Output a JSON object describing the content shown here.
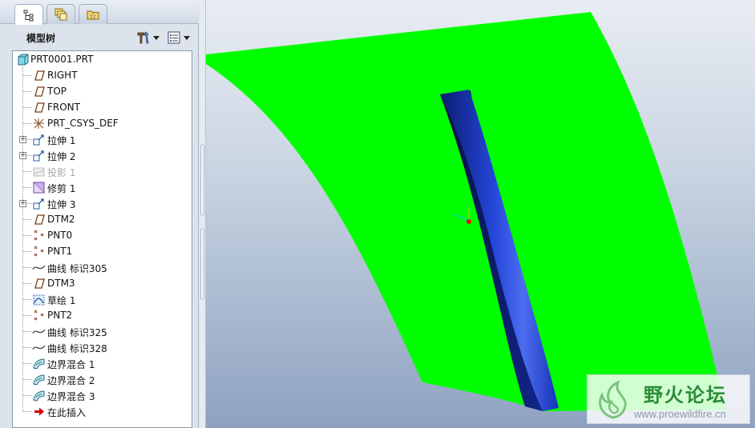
{
  "tabs": [
    {
      "name": "model-tree-tab",
      "icon": "tree-icon",
      "active": true
    },
    {
      "name": "layers-tab",
      "icon": "layers-icon",
      "active": false
    },
    {
      "name": "folder-tab",
      "icon": "folder-star-icon",
      "active": false
    }
  ],
  "tree": {
    "title": "模型树",
    "settings_icon": "tools-icon",
    "show_icon": "list-icon",
    "items": [
      {
        "label": "PRT0001.PRT",
        "icon": "part-icon",
        "expandable": false,
        "suppressed": false
      },
      {
        "label": "RIGHT",
        "icon": "datum-plane-icon",
        "expandable": false,
        "suppressed": false
      },
      {
        "label": "TOP",
        "icon": "datum-plane-icon",
        "expandable": false,
        "suppressed": false
      },
      {
        "label": "FRONT",
        "icon": "datum-plane-icon",
        "expandable": false,
        "suppressed": false
      },
      {
        "label": "PRT_CSYS_DEF",
        "icon": "csys-icon",
        "expandable": false,
        "suppressed": false
      },
      {
        "label": "拉伸 1",
        "icon": "extrude-icon",
        "expandable": true,
        "suppressed": false
      },
      {
        "label": "拉伸 2",
        "icon": "extrude-icon",
        "expandable": true,
        "suppressed": false
      },
      {
        "label": "投影 1",
        "icon": "project-icon",
        "expandable": false,
        "suppressed": true
      },
      {
        "label": "修剪 1",
        "icon": "trim-icon",
        "expandable": false,
        "suppressed": false
      },
      {
        "label": "拉伸 3",
        "icon": "extrude-icon",
        "expandable": true,
        "suppressed": false
      },
      {
        "label": "DTM2",
        "icon": "datum-plane-icon",
        "expandable": false,
        "suppressed": false
      },
      {
        "label": "PNT0",
        "icon": "datum-point-icon",
        "expandable": false,
        "suppressed": false
      },
      {
        "label": "PNT1",
        "icon": "datum-point-icon",
        "expandable": false,
        "suppressed": false
      },
      {
        "label": "曲线 标识305",
        "icon": "curve-icon",
        "expandable": false,
        "suppressed": false
      },
      {
        "label": "DTM3",
        "icon": "datum-plane-icon",
        "expandable": false,
        "suppressed": false
      },
      {
        "label": "草绘 1",
        "icon": "sketch-icon",
        "expandable": false,
        "suppressed": false
      },
      {
        "label": "PNT2",
        "icon": "datum-point-icon",
        "expandable": false,
        "suppressed": false
      },
      {
        "label": "曲线 标识325",
        "icon": "curve-icon",
        "expandable": false,
        "suppressed": false
      },
      {
        "label": "曲线 标识328",
        "icon": "curve-icon",
        "expandable": false,
        "suppressed": false
      },
      {
        "label": "边界混合 1",
        "icon": "boundary-blend-icon",
        "expandable": false,
        "suppressed": false
      },
      {
        "label": "边界混合 2",
        "icon": "boundary-blend-icon",
        "expandable": false,
        "suppressed": false
      },
      {
        "label": "边界混合 3",
        "icon": "boundary-blend-icon",
        "expandable": false,
        "suppressed": false
      },
      {
        "label": "在此插入",
        "icon": "insert-here-arrow-icon",
        "expandable": false,
        "suppressed": false
      }
    ]
  },
  "colors": {
    "surface_green": "#00ff00",
    "blade_blue": "#1f3fd0",
    "blade_dark": "#0a1a66",
    "insert_arrow": "#d40000"
  },
  "watermark": {
    "title": "野火论坛",
    "url": "www.proewildfire.cn",
    "logo_icon": "wildfire-logo-icon"
  }
}
